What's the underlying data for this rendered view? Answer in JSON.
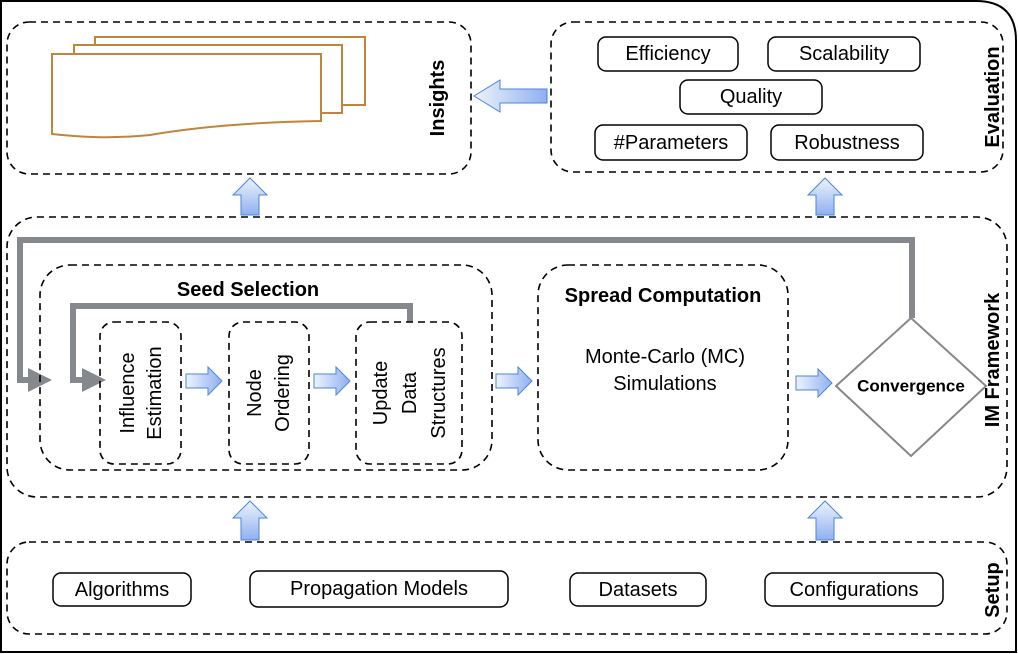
{
  "insights": {
    "label": "Insights"
  },
  "evaluation": {
    "label": "Evaluation",
    "items": [
      "Efficiency",
      "Scalability",
      "Quality",
      "#Parameters",
      "Robustness"
    ]
  },
  "framework": {
    "label": "IM Framework",
    "seed_selection": {
      "title": "Seed Selection",
      "steps": [
        [
          "Influence",
          "Estimation"
        ],
        [
          "Node",
          "Ordering"
        ],
        [
          "Update",
          "Data",
          "Structures"
        ]
      ]
    },
    "spread": {
      "title": "Spread Computation",
      "lines": [
        "Monte-Carlo (MC)",
        "Simulations"
      ]
    },
    "convergence": "Convergence"
  },
  "setup": {
    "label": "Setup",
    "items": [
      "Algorithms",
      "Propagation Models",
      "Datasets",
      "Configurations"
    ]
  },
  "colors": {
    "arrow_blue": "#8fb4f0",
    "loop_gray": "#85888c",
    "doc_orange": "#c0843c"
  }
}
